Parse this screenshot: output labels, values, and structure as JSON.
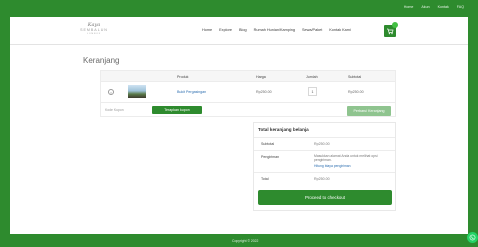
{
  "topbar": {
    "links": [
      "Home",
      "Akun",
      "Kontak",
      "FAQ"
    ]
  },
  "header": {
    "logo_script": "Kaya",
    "logo_word": "SEMBALUN",
    "logo_sub": "LOMBOK",
    "nav": [
      "Home",
      "Explore",
      "Blog",
      "Rumah Hunian/Kamping",
      "Sewa/Paket",
      "Kontak Kami"
    ]
  },
  "cart": {
    "title": "Keranjang",
    "columns": [
      "Produk",
      "Harga",
      "Jumlah",
      "Subtotal"
    ],
    "rows": [
      {
        "product": "Bukit Pergasingan",
        "price": "Rp250.00",
        "qty": "1",
        "subtotal": "Rp250.00"
      }
    ],
    "coupon_placeholder": "Kode Kupon",
    "apply_coupon_label": "Terapkan kupon",
    "update_cart_label": "Perbarui Keranjang"
  },
  "totals": {
    "title": "Total keranjang belanja",
    "subtotal_label": "Subtotal",
    "subtotal_value": "Rp250.00",
    "shipping_label": "Pengiriman",
    "shipping_note": "Masukkan alamat Anda untuk melihat opsi pengiriman.",
    "shipping_link": "Hitung biaya pengiriman",
    "total_label": "Total",
    "total_value": "Rp250.00",
    "checkout_label": "Proceed to checkout"
  },
  "footer": {
    "copyright": "Copyright © 2022"
  },
  "colors": {
    "brand_green": "#2e8b2e",
    "link_blue": "#2e6fb0",
    "whatsapp": "#25d366"
  }
}
